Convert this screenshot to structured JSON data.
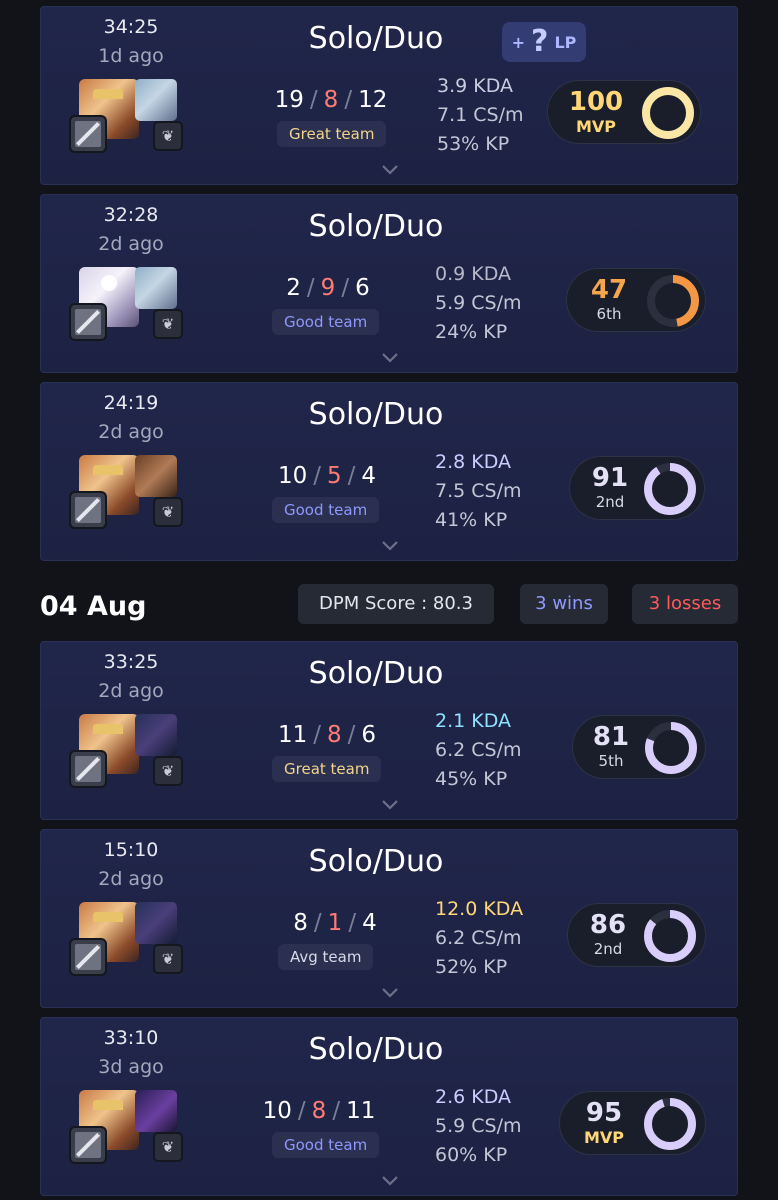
{
  "top_lp_chip": {
    "plus": "+",
    "question": "?",
    "lp": "LP"
  },
  "day_header": {
    "date": "04 Aug",
    "dpm_score": "DPM Score : 80.3",
    "wins": "3 wins",
    "losses": "3 losses"
  },
  "colors": {
    "great_team": "#f2d58a",
    "good_team": "#8e98ff",
    "avg_team": "#d8dae6",
    "deaths": "#ff7b73",
    "mvp": "#ffd777",
    "orange": "#f4a54d",
    "ring_purple": "#d9cdfb",
    "ring_gold": "#fbe6a6",
    "ring_orange": "#f39744",
    "kda_blue": "#8ee1ff",
    "kda_gold": "#ffd777"
  },
  "matches": [
    {
      "duration": "34:25",
      "ago": "1d ago",
      "queue": "Solo/Duo",
      "kills": "19",
      "deaths": "8",
      "assists": "12",
      "team": "Great team",
      "kda": "3.9 KDA",
      "cs": "7.1 CS/m",
      "kp": "53% KP",
      "score": "100",
      "rank": "MVP",
      "score_fraction": 1.0
    },
    {
      "duration": "32:28",
      "ago": "2d ago",
      "queue": "Solo/Duo",
      "kills": "2",
      "deaths": "9",
      "assists": "6",
      "team": "Good team",
      "kda": "0.9 KDA",
      "cs": "5.9 CS/m",
      "kp": "24% KP",
      "score": "47",
      "rank": "6th",
      "score_fraction": 0.47
    },
    {
      "duration": "24:19",
      "ago": "2d ago",
      "queue": "Solo/Duo",
      "kills": "10",
      "deaths": "5",
      "assists": "4",
      "team": "Good team",
      "kda": "2.8 KDA",
      "cs": "7.5 CS/m",
      "kp": "41% KP",
      "score": "91",
      "rank": "2nd",
      "score_fraction": 0.91
    },
    {
      "duration": "33:25",
      "ago": "2d ago",
      "queue": "Solo/Duo",
      "kills": "11",
      "deaths": "8",
      "assists": "6",
      "team": "Great team",
      "kda": "2.1 KDA",
      "cs": "6.2 CS/m",
      "kp": "45% KP",
      "score": "81",
      "rank": "5th",
      "score_fraction": 0.81
    },
    {
      "duration": "15:10",
      "ago": "2d ago",
      "queue": "Solo/Duo",
      "kills": "8",
      "deaths": "1",
      "assists": "4",
      "team": "Avg team",
      "kda": "12.0 KDA",
      "cs": "6.2 CS/m",
      "kp": "52% KP",
      "score": "86",
      "rank": "2nd",
      "score_fraction": 0.86
    },
    {
      "duration": "33:10",
      "ago": "3d ago",
      "queue": "Solo/Duo",
      "kills": "10",
      "deaths": "8",
      "assists": "11",
      "team": "Good team",
      "kda": "2.6 KDA",
      "cs": "5.9 CS/m",
      "kp": "60% KP",
      "score": "95",
      "rank": "MVP",
      "score_fraction": 0.95
    }
  ]
}
